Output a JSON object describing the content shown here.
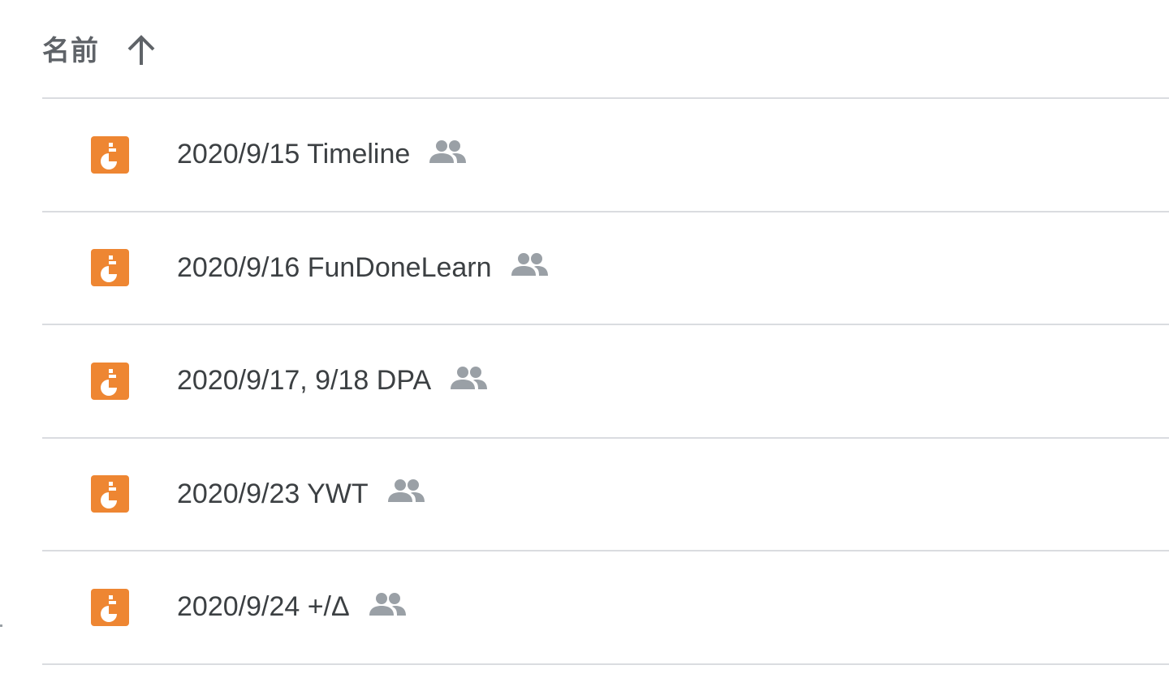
{
  "header": {
    "name_label": "名前",
    "sort_direction": "ascending"
  },
  "files": [
    {
      "name": "2020/9/15 Timeline",
      "type": "jamboard",
      "shared": true
    },
    {
      "name": "2020/9/16 FunDoneLearn",
      "type": "jamboard",
      "shared": true
    },
    {
      "name": "2020/9/17, 9/18 DPA",
      "type": "jamboard",
      "shared": true
    },
    {
      "name": "2020/9/23 YWT",
      "type": "jamboard",
      "shared": true
    },
    {
      "name": "2020/9/24 +/Δ",
      "type": "jamboard",
      "shared": true
    }
  ],
  "colors": {
    "jamboard_orange": "#ee8632",
    "shared_icon_gray": "#9aa0a6",
    "divider": "#dadce0",
    "text": "#3c4043"
  }
}
